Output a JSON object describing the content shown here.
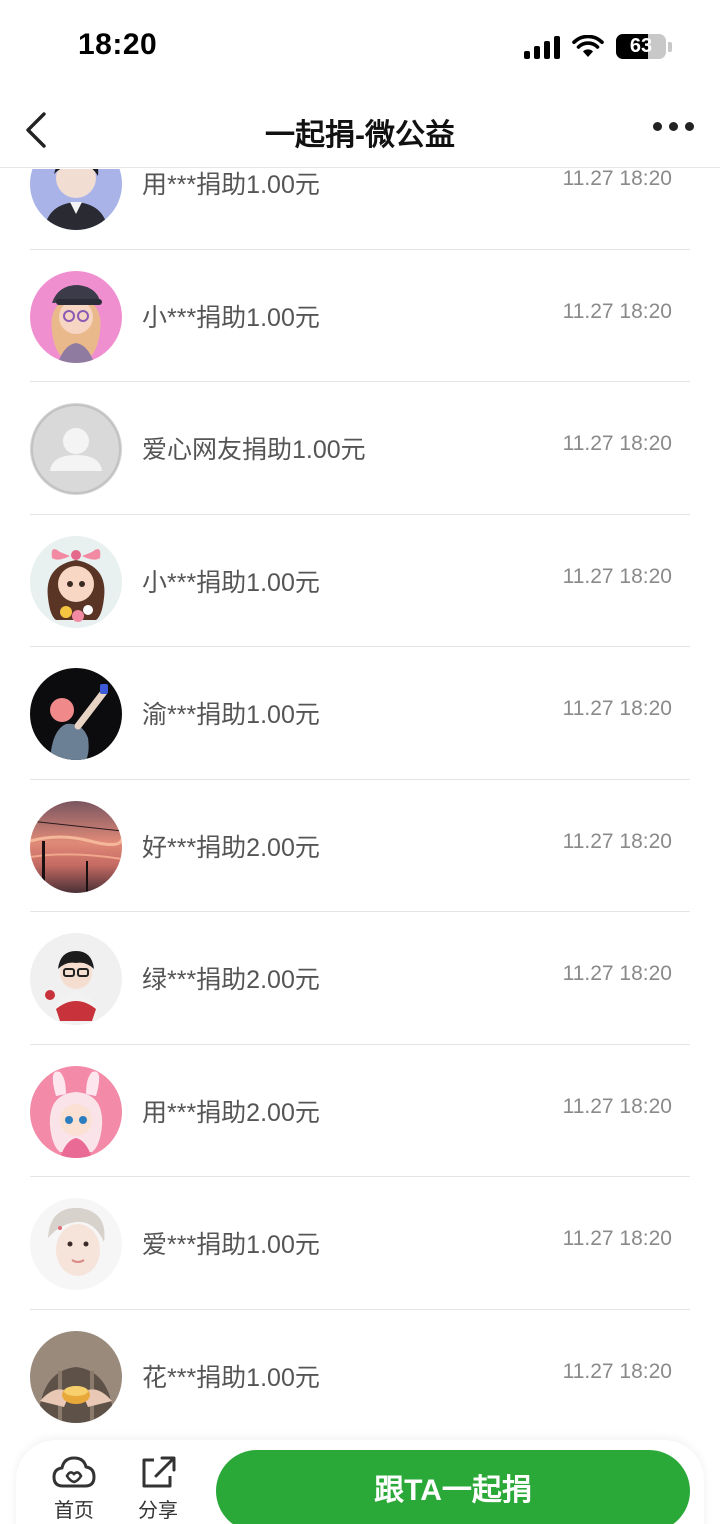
{
  "status_bar": {
    "time": "18:20",
    "battery_level": "63",
    "icons": [
      "cellular-signal-icon",
      "wifi-icon",
      "battery-icon"
    ]
  },
  "nav": {
    "title": "一起捐-微公益",
    "back_icon": "chevron-left-icon",
    "more_icon": "more-dots-icon"
  },
  "donations": [
    {
      "text": "用***捐助1.00元",
      "time": "11.27 18:20",
      "avatar": "boy-portrait"
    },
    {
      "text": "小***捐助1.00元",
      "time": "11.27 18:20",
      "avatar": "cartoon-girl-cap"
    },
    {
      "text": "爱心网友捐助1.00元",
      "time": "11.27 18:20",
      "avatar": "default-user"
    },
    {
      "text": "小***捐助1.00元",
      "time": "11.27 18:20",
      "avatar": "cartoon-girl-bow"
    },
    {
      "text": "渝***捐助1.00元",
      "time": "11.27 18:20",
      "avatar": "dark-figure"
    },
    {
      "text": "好***捐助2.00元",
      "time": "11.27 18:20",
      "avatar": "sunset-sky"
    },
    {
      "text": "绿***捐助2.00元",
      "time": "11.27 18:20",
      "avatar": "boy-glasses"
    },
    {
      "text": "用***捐助2.00元",
      "time": "11.27 18:20",
      "avatar": "cartoon-bunny-girl"
    },
    {
      "text": "爱***捐助1.00元",
      "time": "11.27 18:20",
      "avatar": "young-man"
    },
    {
      "text": "花***捐助1.00元",
      "time": "11.27 18:20",
      "avatar": "hands-holding-cake"
    }
  ],
  "bottom_bar": {
    "home_label": "首页",
    "share_label": "分享",
    "donate_label": "跟TA一起捐",
    "accent_color": "#2aa838"
  }
}
